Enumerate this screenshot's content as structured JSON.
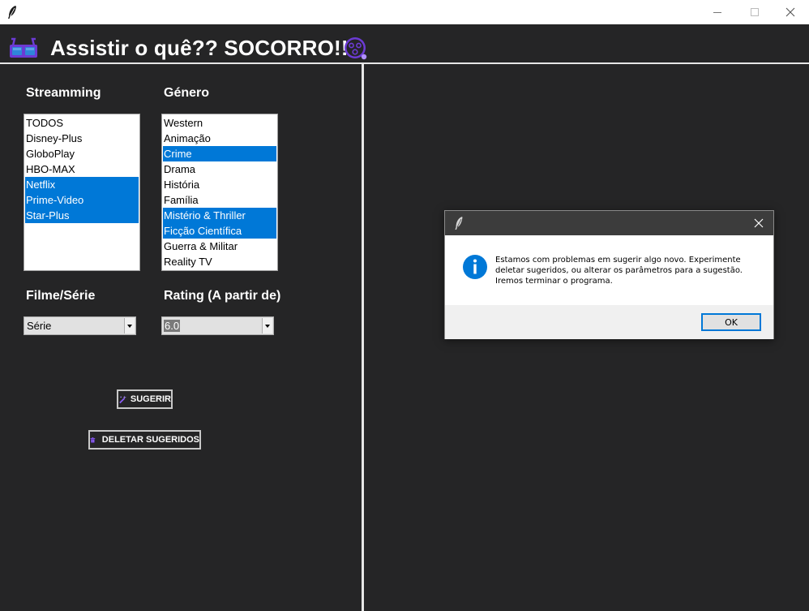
{
  "window": {
    "app_icon": "feather-icon",
    "controls": [
      "minimize-icon",
      "maximize-icon",
      "close-icon"
    ]
  },
  "header": {
    "title": "Assistir o quê?? SOCORRO!!!",
    "left_icon": "3d-glasses-icon",
    "right_icon": "confused-face-icon"
  },
  "streaming": {
    "label": "Streamming",
    "items": [
      {
        "label": "TODOS",
        "selected": false
      },
      {
        "label": "Disney-Plus",
        "selected": false
      },
      {
        "label": "GloboPlay",
        "selected": false
      },
      {
        "label": "HBO-MAX",
        "selected": false
      },
      {
        "label": "Netflix",
        "selected": true
      },
      {
        "label": "Prime-Video",
        "selected": true
      },
      {
        "label": "Star-Plus",
        "selected": true
      }
    ]
  },
  "genre": {
    "label": "Género",
    "items": [
      {
        "label": "Western",
        "selected": false
      },
      {
        "label": "Animação",
        "selected": false
      },
      {
        "label": "Crime",
        "selected": true
      },
      {
        "label": "Drama",
        "selected": false
      },
      {
        "label": "História",
        "selected": false
      },
      {
        "label": "Família",
        "selected": false
      },
      {
        "label": "Mistério & Thriller",
        "selected": true
      },
      {
        "label": "Ficção Científica",
        "selected": true
      },
      {
        "label": "Guerra & Militar",
        "selected": false
      },
      {
        "label": "Reality TV",
        "selected": false
      }
    ]
  },
  "type_select": {
    "label": "Filme/Série",
    "value": "Série"
  },
  "rating_select": {
    "label": "Rating (A partir de)",
    "value": "6.0"
  },
  "buttons": {
    "suggest": {
      "label": "SUGERIR",
      "icon": "magic-wand-icon"
    },
    "delete": {
      "label": "DELETAR SUGERIDOS",
      "icon": "trash-can-icon"
    }
  },
  "dialog": {
    "title": "",
    "icon": "info-icon",
    "message_lines": [
      "Estamos com problemas em sugerir algo novo. Experimente",
      "deletar sugeridos, ou alterar os parâmetros para a sugestão.",
      "Iremos terminar o programa."
    ],
    "ok_label": "OK"
  },
  "colors": {
    "background": "#252526",
    "selection": "#0078d7",
    "accent_purple": "#6c3bd4"
  }
}
